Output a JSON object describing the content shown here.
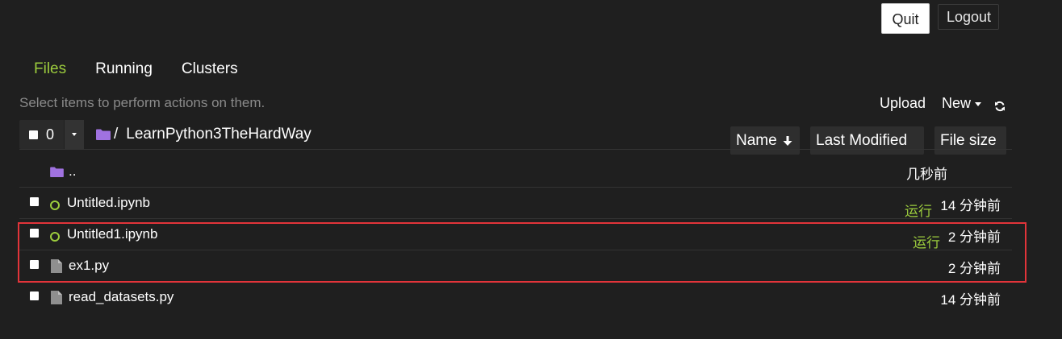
{
  "header": {
    "quit_label": "Quit",
    "logout_label": "Logout"
  },
  "tabs": [
    {
      "label": "Files",
      "active": true
    },
    {
      "label": "Running",
      "active": false
    },
    {
      "label": "Clusters",
      "active": false
    }
  ],
  "toolbar": {
    "hint": "Select items to perform actions on them.",
    "upload_label": "Upload",
    "new_label": "New",
    "refresh_icon": "refresh-icon"
  },
  "selection": {
    "count": "0"
  },
  "breadcrumb": {
    "root_sep": "/",
    "folder": "LearnPython3TheHardWay"
  },
  "columns": {
    "name": "Name",
    "last_modified": "Last Modified",
    "file_size": "File size"
  },
  "items": [
    {
      "name": "..",
      "type": "folder",
      "status": "",
      "modified": "几秒前"
    },
    {
      "name": "Untitled.ipynb",
      "type": "notebook",
      "status": "运行",
      "modified": "14 分钟前"
    },
    {
      "name": "Untitled1.ipynb",
      "type": "notebook",
      "status": "运行",
      "modified": "2 分钟前"
    },
    {
      "name": "ex1.py",
      "type": "file",
      "status": "",
      "modified": "2 分钟前"
    },
    {
      "name": "read_datasets.py",
      "type": "file",
      "status": "",
      "modified": "14 分钟前"
    }
  ],
  "colors": {
    "accent": "#9ccc3d",
    "folder": "#a072e0",
    "highlight": "#e2343a",
    "background": "#1f1f1f"
  }
}
